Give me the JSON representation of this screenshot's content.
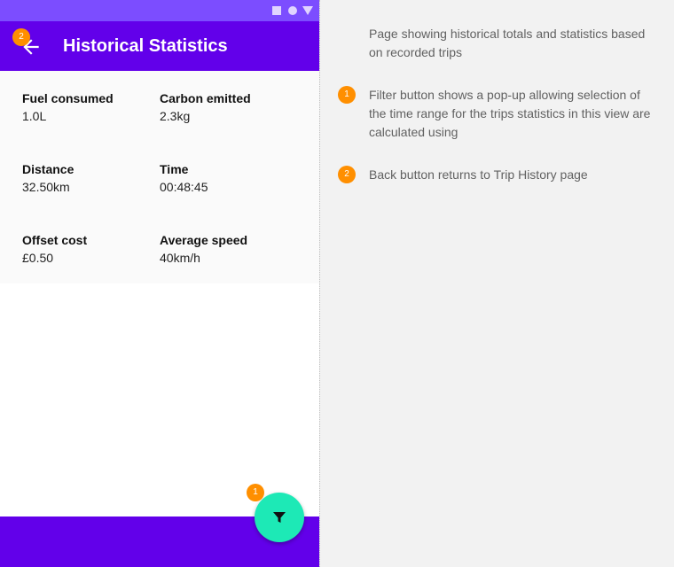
{
  "app_bar": {
    "title": "Historical Statistics"
  },
  "stats": [
    {
      "label": "Fuel consumed",
      "value": "1.0L"
    },
    {
      "label": "Carbon emitted",
      "value": "2.3kg"
    },
    {
      "label": "Distance",
      "value": "32.50km"
    },
    {
      "label": "Time",
      "value": "00:48:45"
    },
    {
      "label": "Offset cost",
      "value": "£0.50"
    },
    {
      "label": "Average speed",
      "value": "40km/h"
    }
  ],
  "markers": {
    "filter": "1",
    "back": "2"
  },
  "annotations": {
    "intro": "Page showing historical totals and statistics based on recorded trips",
    "items": [
      {
        "number": "1",
        "text": "Filter button shows a pop-up allowing selection of the time range for the trips statistics in this view are calculated using"
      },
      {
        "number": "2",
        "text": "Back button returns to Trip History page"
      }
    ]
  },
  "icons": {
    "back": "arrow-left-icon",
    "fab": "filter-icon"
  },
  "colors": {
    "primary": "#6200ea",
    "status_bar": "#7c4dff",
    "fab": "#1de9b6",
    "marker": "#ff8f00"
  }
}
